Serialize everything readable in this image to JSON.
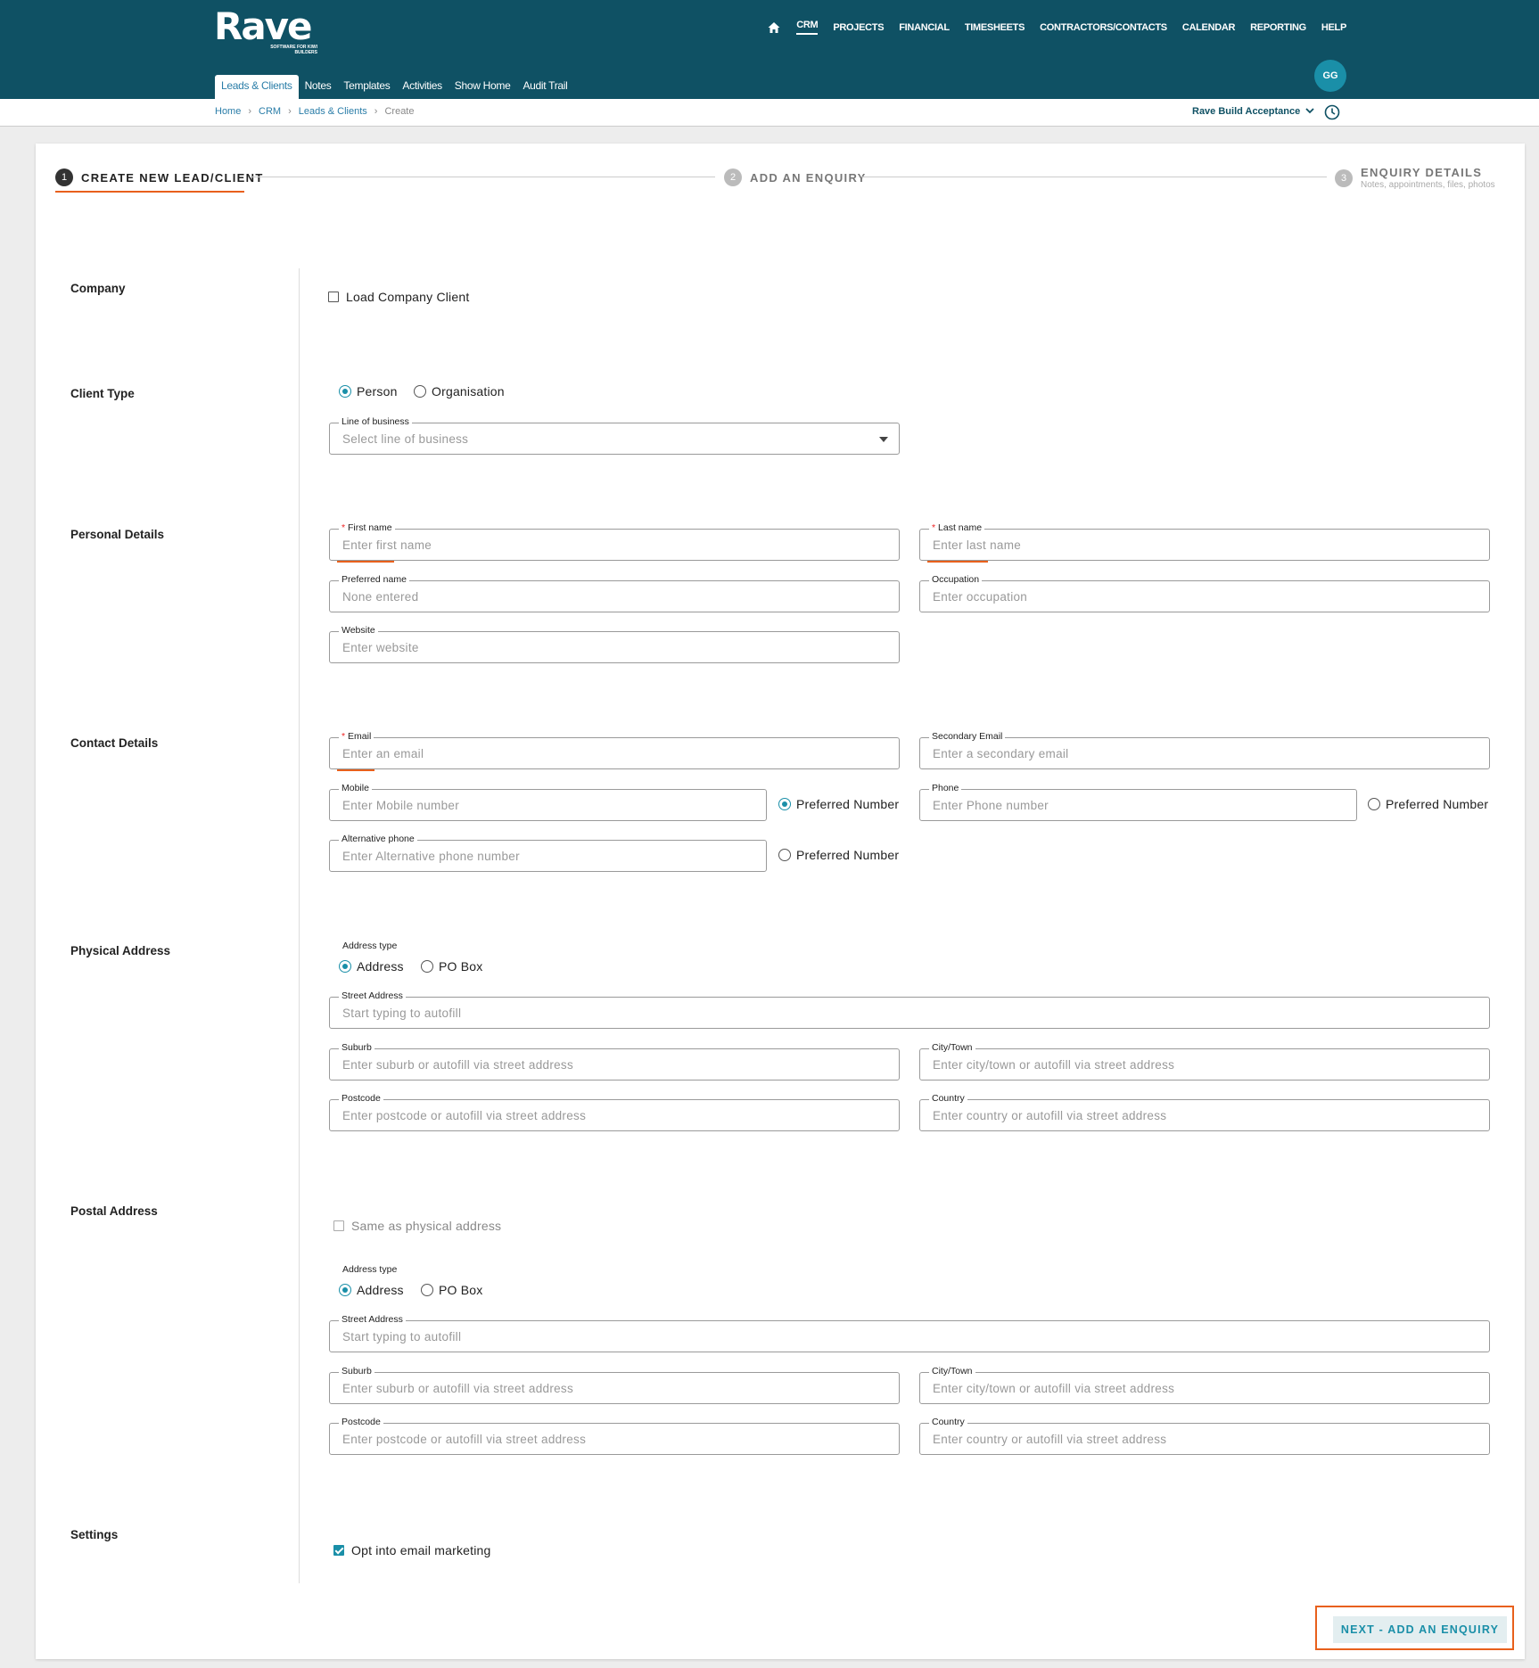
{
  "brand": {
    "name": "Rave",
    "tagline": "SOFTWARE FOR KIWI BUILDERS"
  },
  "topnav": [
    "CRM",
    "PROJECTS",
    "FINANCIAL",
    "TIMESHEETS",
    "CONTRACTORS/CONTACTS",
    "CALENDAR",
    "REPORTING",
    "HELP"
  ],
  "subtabs": [
    "Leads & Clients",
    "Notes",
    "Templates",
    "Activities",
    "Show Home",
    "Audit Trail"
  ],
  "user": {
    "initials": "GG"
  },
  "breadcrumb": [
    "Home",
    "CRM",
    "Leads & Clients",
    "Create"
  ],
  "org": "Rave Build Acceptance",
  "steps": [
    {
      "num": "1",
      "label": "CREATE NEW LEAD/CLIENT"
    },
    {
      "num": "2",
      "label": "ADD AN ENQUIRY"
    },
    {
      "num": "3",
      "label": "ENQUIRY DETAILS",
      "sub": "Notes, appointments, files, photos"
    }
  ],
  "sections": {
    "company": "Company",
    "client_type": "Client Type",
    "personal": "Personal Details",
    "contact": "Contact Details",
    "physical": "Physical Address",
    "postal": "Postal Address",
    "settings": "Settings"
  },
  "company": {
    "load_label": "Load Company Client"
  },
  "client_type": {
    "person": "Person",
    "organisation": "Organisation",
    "lob_label": "Line of business",
    "lob_placeholder": "Select line of business"
  },
  "personal": {
    "first_label": "First name",
    "first_ph": "Enter first name",
    "last_label": "Last name",
    "last_ph": "Enter last name",
    "pref_label": "Preferred name",
    "pref_ph": "None entered",
    "occ_label": "Occupation",
    "occ_ph": "Enter occupation",
    "web_label": "Website",
    "web_ph": "Enter website"
  },
  "contact": {
    "email_label": "Email",
    "email_ph": "Enter an email",
    "sec_email_label": "Secondary Email",
    "sec_email_ph": "Enter a secondary email",
    "mobile_label": "Mobile",
    "mobile_ph": "Enter Mobile number",
    "phone_label": "Phone",
    "phone_ph": "Enter Phone number",
    "alt_label": "Alternative phone",
    "alt_ph": "Enter Alternative phone number",
    "preferred": "Preferred Number"
  },
  "address": {
    "type_label": "Address type",
    "opt_address": "Address",
    "opt_po": "PO Box",
    "street_label": "Street Address",
    "street_ph": "Start typing to autofill",
    "suburb_label": "Suburb",
    "suburb_ph": "Enter suburb or autofill via street address",
    "city_label": "City/Town",
    "city_ph": "Enter city/town or autofill via street address",
    "post_label": "Postcode",
    "post_ph": "Enter postcode or autofill via street address",
    "country_label": "Country",
    "country_ph": "Enter country or autofill via street address"
  },
  "postal": {
    "same_label": "Same as physical address"
  },
  "settings": {
    "optin_label": "Opt into email marketing"
  },
  "next_label": "NEXT - ADD AN ENQUIRY",
  "colors": {
    "header": "#0f5164",
    "accent": "#1a8fa8",
    "highlight": "#e8601c"
  }
}
